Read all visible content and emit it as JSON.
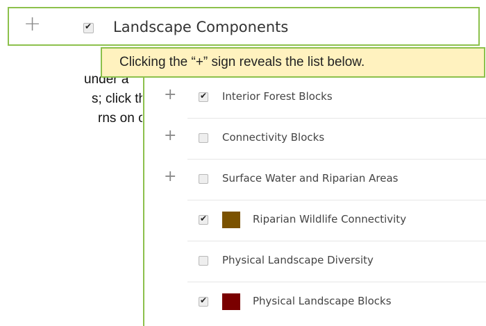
{
  "header": {
    "expand_symbol": "+",
    "checked": true,
    "title": "Landscape Components"
  },
  "callout": {
    "text": "Clicking the “+” sign reveals the list below."
  },
  "side_text": {
    "line1": "under a",
    "line2": "s; click the “-“",
    "line3": "rns on or off"
  },
  "layers": [
    {
      "label": "Interior Forest Blocks",
      "checked": true,
      "has_expand": true,
      "expand_symbol": "+"
    },
    {
      "label": "Connectivity Blocks",
      "checked": false,
      "has_expand": true,
      "expand_symbol": "+"
    },
    {
      "label": "Surface Water and Riparian Areas",
      "checked": false,
      "has_expand": true,
      "expand_symbol": "+"
    },
    {
      "label": "Riparian Wildlife Connectivity",
      "checked": true,
      "swatch": "#7b5200"
    },
    {
      "label": "Physical Landscape Diversity",
      "checked": false
    },
    {
      "label": "Physical Landscape Blocks",
      "checked": true,
      "swatch": "#7a0000"
    }
  ]
}
